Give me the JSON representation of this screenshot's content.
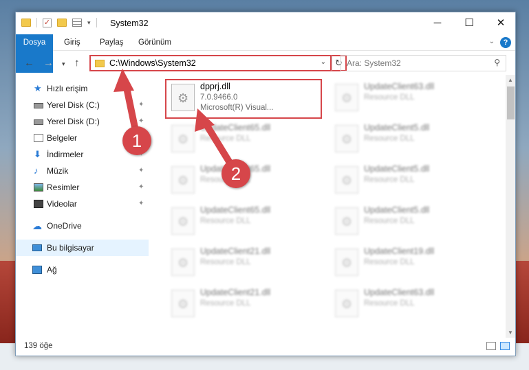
{
  "title": "System32",
  "ribbon": {
    "file_tab": "Dosya",
    "tabs": [
      "Giriş",
      "Paylaş",
      "Görünüm"
    ],
    "help": "?"
  },
  "address": {
    "path": "C:\\Windows\\System32",
    "search_placeholder": "Ara: System32"
  },
  "sidebar": {
    "items": [
      {
        "label": "Hızlı erişim"
      },
      {
        "label": "Yerel Disk (C:)"
      },
      {
        "label": "Yerel Disk (D:)"
      },
      {
        "label": "Belgeler"
      },
      {
        "label": "İndirmeler"
      },
      {
        "label": "Müzik"
      },
      {
        "label": "Resimler"
      },
      {
        "label": "Videolar"
      },
      {
        "label": "OneDrive"
      },
      {
        "label": "Bu bilgisayar"
      },
      {
        "label": "Ağ"
      }
    ]
  },
  "files": {
    "highlighted": {
      "name": "dpprj.dll",
      "version": "7.0.9466.0",
      "desc": "Microsoft(R) Visual..."
    },
    "blurred": [
      {
        "name": "UpdateClient63.dll",
        "desc": "Resource DLL"
      },
      {
        "name": "UpdateClient65.dll",
        "desc": "Resource DLL"
      },
      {
        "name": "UpdateClient5.dll",
        "desc": "Resource DLL"
      },
      {
        "name": "UpdateClient65.dll",
        "desc": "Resource DLL"
      },
      {
        "name": "UpdateClient5.dll",
        "desc": "Resource DLL"
      },
      {
        "name": "UpdateClient65.dll",
        "desc": "Resource DLL"
      },
      {
        "name": "UpdateClient5.dll",
        "desc": "Resource DLL"
      },
      {
        "name": "UpdateClient21.dll",
        "desc": "Resource DLL"
      },
      {
        "name": "UpdateClient19.dll",
        "desc": "Resource DLL"
      },
      {
        "name": "UpdateClient21.dll",
        "desc": "Resource DLL"
      },
      {
        "name": "UpdateClient63.dll",
        "desc": "Resource DLL"
      }
    ]
  },
  "status": {
    "count": "139 öğe"
  },
  "annotations": {
    "step1": "1",
    "step2": "2"
  },
  "colors": {
    "accent": "#1979ca",
    "highlight": "#d6464a"
  }
}
